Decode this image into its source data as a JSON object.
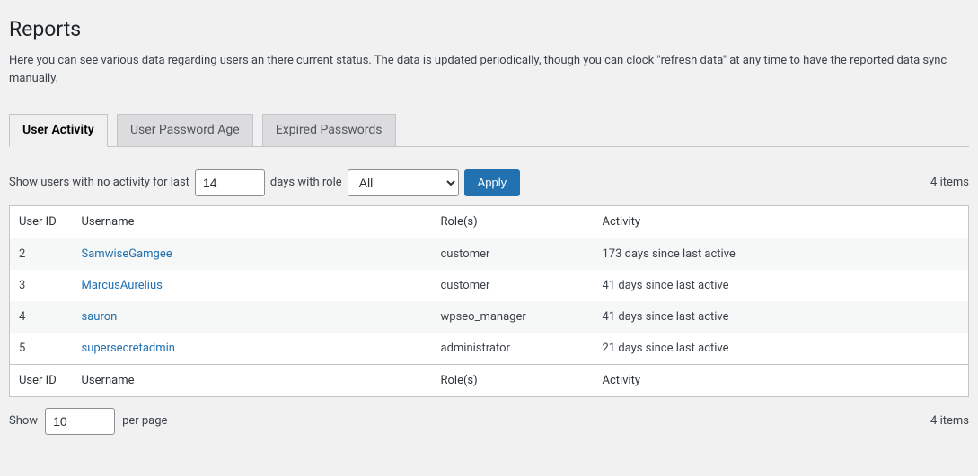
{
  "page": {
    "title": "Reports",
    "intro": "Here you can see various data regarding users an there current status. The data is updated periodically, though you can clock \"refresh data\" at any time to have the reported data sync manually."
  },
  "tabs": [
    {
      "label": "User Activity",
      "active": true
    },
    {
      "label": "User Password Age",
      "active": false
    },
    {
      "label": "Expired Passwords",
      "active": false
    }
  ],
  "filter": {
    "prefix_text": "Show users with no activity for last",
    "days_value": "14",
    "mid_text": "days with role",
    "role_value": "All",
    "apply_label": "Apply"
  },
  "items_count_top": "4 items",
  "table": {
    "headers": {
      "user_id": "User ID",
      "username": "Username",
      "roles": "Role(s)",
      "activity": "Activity"
    },
    "rows": [
      {
        "user_id": "2",
        "username": "SamwiseGamgee",
        "roles": "customer",
        "activity": "173 days since last active"
      },
      {
        "user_id": "3",
        "username": "MarcusAurelius",
        "roles": "customer",
        "activity": "41 days since last active"
      },
      {
        "user_id": "4",
        "username": "sauron",
        "roles": "wpseo_manager",
        "activity": "41 days since last active"
      },
      {
        "user_id": "5",
        "username": "supersecretadmin",
        "roles": "administrator",
        "activity": "21 days since last active"
      }
    ]
  },
  "pager": {
    "show_label": "Show",
    "per_page_value": "10",
    "per_page_label": "per page"
  },
  "items_count_bottom": "4 items"
}
